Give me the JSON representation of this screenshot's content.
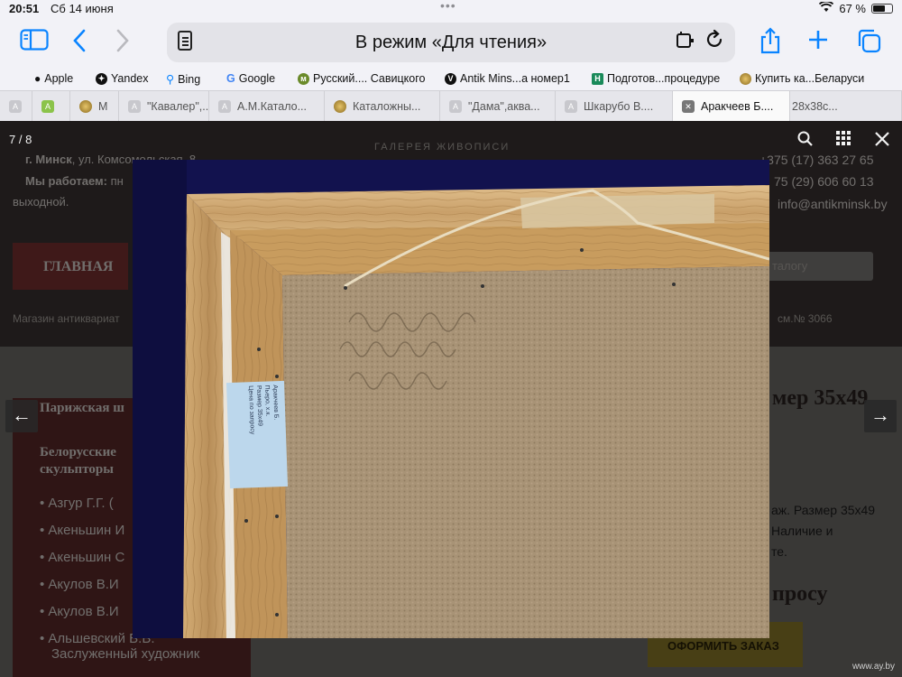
{
  "status": {
    "time": "20:51",
    "date": "Сб 14 июня",
    "battery": "67 %",
    "battery_level": 0.67
  },
  "toolbar": {
    "address_text": "В режим «Для чтения»"
  },
  "favorites": [
    {
      "label": "Apple"
    },
    {
      "label": "Yandex"
    },
    {
      "label": "Bing"
    },
    {
      "label": "Google"
    },
    {
      "label": "Русский.... Савицкого"
    },
    {
      "label": "Antik Mins...а номер1"
    },
    {
      "label": "Подготов...процедуре"
    },
    {
      "label": "Купить ка...Беларуси"
    }
  ],
  "tabs": [
    {
      "label": ""
    },
    {
      "label": ""
    },
    {
      "label": "М"
    },
    {
      "label": "\"Кавалер\",..."
    },
    {
      "label": "А.М.Катало..."
    },
    {
      "label": "Каталожны..."
    },
    {
      "label": "\"Дама\",аква..."
    },
    {
      "label": "Шкарубо В...."
    },
    {
      "label": "Аракчеев Б...."
    },
    {
      "label": "28х38с..."
    }
  ],
  "viewer": {
    "counter": "7 / 8",
    "watermark": "www.ay.by"
  },
  "background": {
    "gallery_caption": "ГАЛЕРЕЯ ЖИВОПИСИ",
    "city_bold": "г. Минск",
    "address": ", ул. Комсомольская, 8",
    "hours_bold": "Мы работаем:",
    "hours_tail": " пн",
    "day_off": "выходной.",
    "phone1": "+375 (17) 363 27 65",
    "phone2": "75 (29) 606 60 13",
    "email": "info@antikminsk.by",
    "nav_main": "ГЛАВНАЯ",
    "search_placeholder": "талогу",
    "breadcrumb": "Магазин антиквариат",
    "cert": "см.№ 3066",
    "category_header": "Парижская ш",
    "section_line1": "Белорусские",
    "section_line2": "скульпторы",
    "artists": [
      "Азгур Г.Г. (",
      "Акеньшин И",
      "Акеньшин С",
      "Акулов В.И",
      "Акулов В.И",
      "Альшевский В.В.",
      "Заслуженный художник"
    ],
    "size_heading": "мер 35х49",
    "desc1": "аж. Размер 35х49",
    "desc2": "Наличие и",
    "desc3": "те.",
    "request_heading": "просу",
    "order_button": "ОФОРМИТЬ ЗАКАЗ"
  },
  "photo_label": {
    "lines": [
      "Аракчеев Б.",
      "Пьеро, х.к.",
      "Размер 35х49",
      "Цена по запросу"
    ]
  }
}
